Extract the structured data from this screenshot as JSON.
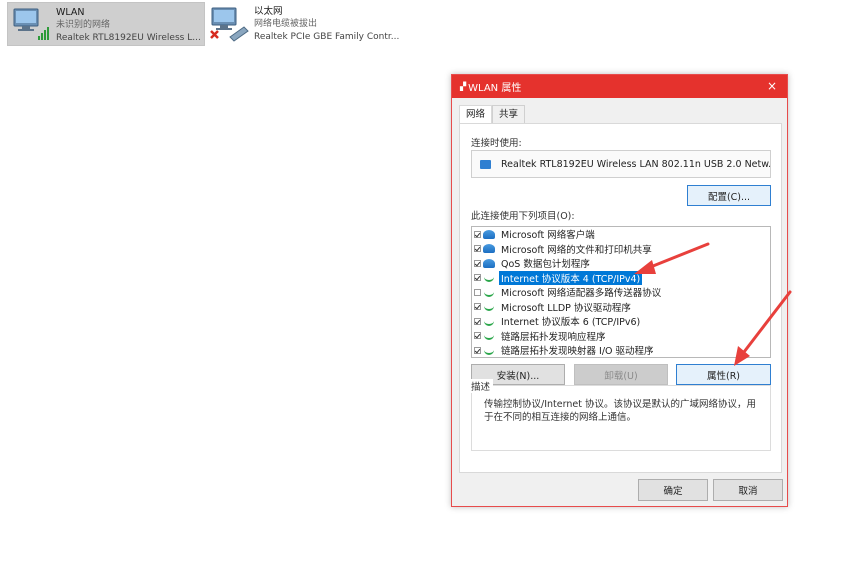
{
  "adapters": [
    {
      "name": "WLAN",
      "status": "未识别的网络",
      "device": "Realtek RTL8192EU Wireless L...",
      "selected": true
    },
    {
      "name": "以太网",
      "status": "网络电缆被拔出",
      "device": "Realtek PCIe GBE Family Contr...",
      "selected": false
    }
  ],
  "dialog": {
    "title": "WLAN 属性",
    "close_icon": "×",
    "tabs": [
      "网络",
      "共享"
    ],
    "connect_using_label": "连接时使用:",
    "device_name": "Realtek RTL8192EU Wireless LAN 802.11n USB 2.0 Netw...",
    "configure_button": "配置(C)...",
    "items_label": "此连接使用下列项目(O):",
    "items": [
      {
        "label": "Microsoft 网络客户端",
        "checked": true,
        "icon": "client-icon"
      },
      {
        "label": "Microsoft 网络的文件和打印机共享",
        "checked": true,
        "icon": "client-icon"
      },
      {
        "label": "QoS 数据包计划程序",
        "checked": true,
        "icon": "client-icon"
      },
      {
        "label": "Internet 协议版本 4 (TCP/IPv4)",
        "checked": true,
        "icon": "protocol-icon",
        "selected": true
      },
      {
        "label": "Microsoft 网络适配器多路传送器协议",
        "checked": false,
        "icon": "protocol-icon"
      },
      {
        "label": "Microsoft LLDP 协议驱动程序",
        "checked": true,
        "icon": "protocol-icon"
      },
      {
        "label": "Internet 协议版本 6 (TCP/IPv6)",
        "checked": true,
        "icon": "protocol-icon"
      },
      {
        "label": "链路层拓扑发现响应程序",
        "checked": true,
        "icon": "protocol-icon"
      },
      {
        "label": "链路层拓扑发现映射器 I/O 驱动程序",
        "checked": true,
        "icon": "protocol-icon"
      }
    ],
    "install_button": "安装(N)...",
    "uninstall_button": "卸载(U)",
    "properties_button": "属性(R)",
    "description_label": "描述",
    "description_text": "传输控制协议/Internet 协议。该协议是默认的广域网络协议，用于在不同的相互连接的网络上通信。",
    "ok_button": "确定",
    "cancel_button": "取消"
  },
  "colors": {
    "title_bar": "#e5322d",
    "selection": "#0078d7",
    "annotation_arrow": "#e8403c"
  }
}
